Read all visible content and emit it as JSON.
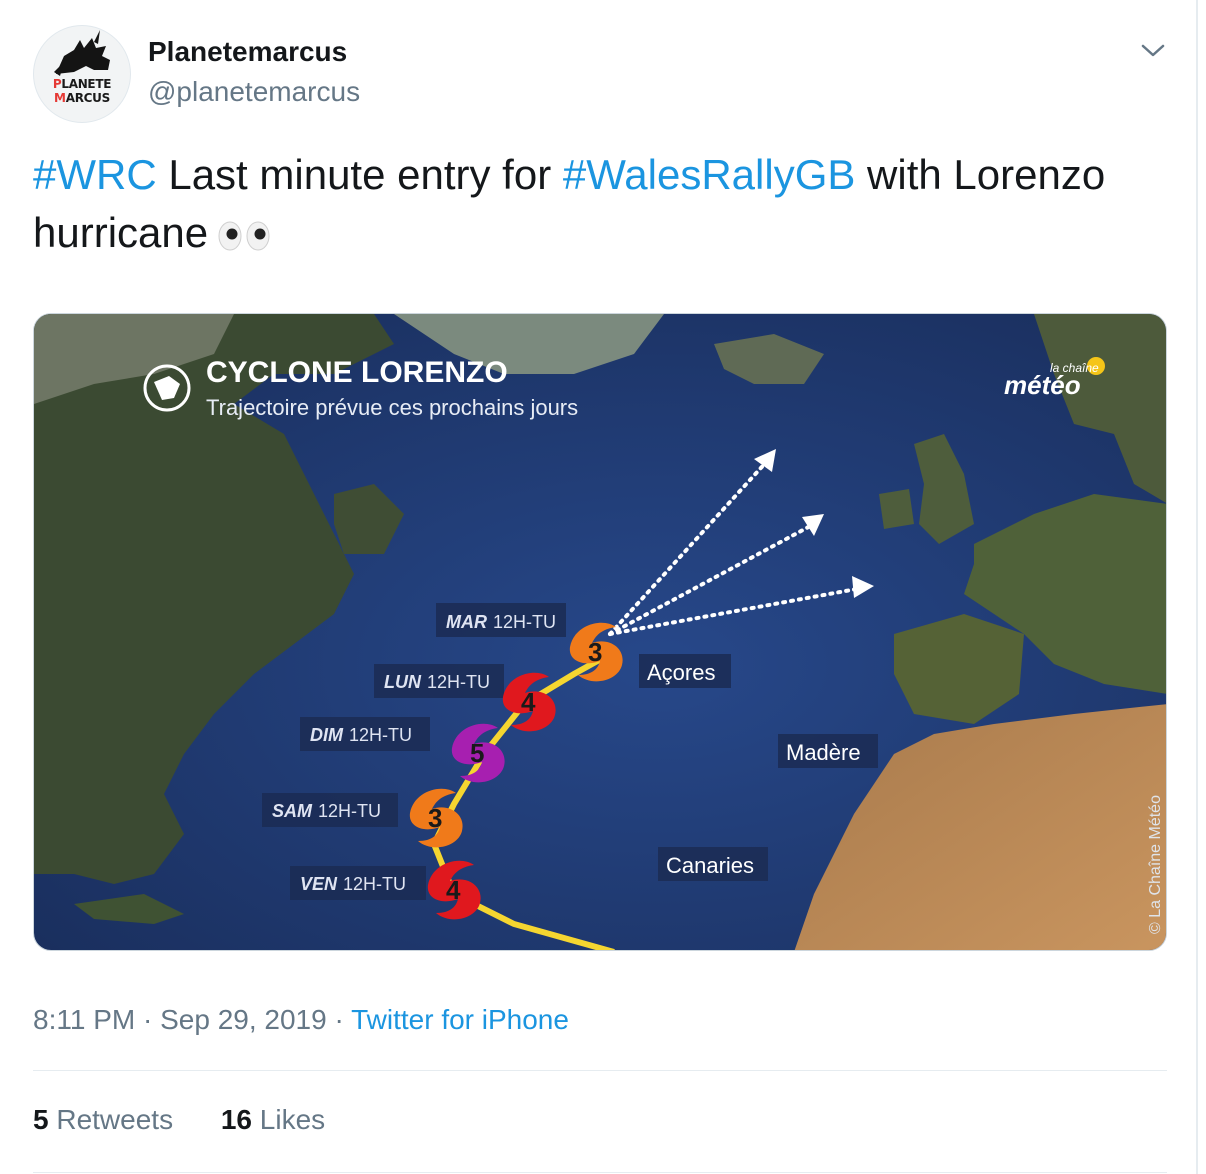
{
  "account": {
    "name": "Planetemarcus",
    "handle": "@planetemarcus",
    "avatar_line1": "PLANETE",
    "avatar_line2": "MARCUS"
  },
  "tweet": {
    "hashtag1": "#WRC",
    "text1": " Last minute entry for ",
    "hashtag2": "#WalesRallyGB",
    "text2": " with Lorenzo hurricane",
    "emoji": "eyes-emoji"
  },
  "media": {
    "title": "CYCLONE LORENZO",
    "subtitle": "Trajectoire prévue ces prochains jours",
    "brand_small": "la chaîne",
    "brand": "météo",
    "copyright": "© La Chaîne Météo",
    "track": [
      {
        "day": "MAR",
        "time": "12H-TU",
        "category": "3"
      },
      {
        "day": "LUN",
        "time": "12H-TU",
        "category": "4"
      },
      {
        "day": "DIM",
        "time": "12H-TU",
        "category": "5"
      },
      {
        "day": "SAM",
        "time": "12H-TU",
        "category": "3"
      },
      {
        "day": "VEN",
        "time": "12H-TU",
        "category": "4"
      }
    ],
    "places": {
      "acores": "Açores",
      "madere": "Madère",
      "canaries": "Canaries"
    },
    "colors": {
      "ocean": "#1f3a73",
      "cat3": "#f07a1a",
      "cat4": "#e0181e",
      "cat5": "#a71fb0",
      "track": "#f5d630"
    }
  },
  "meta": {
    "time": "8:11 PM",
    "sep1": " · ",
    "date": "Sep 29, 2019",
    "sep2": " · ",
    "source": "Twitter for iPhone"
  },
  "stats": {
    "retweets_count": "5",
    "retweets_label": " Retweets",
    "likes_count": "16",
    "likes_label": " Likes"
  }
}
